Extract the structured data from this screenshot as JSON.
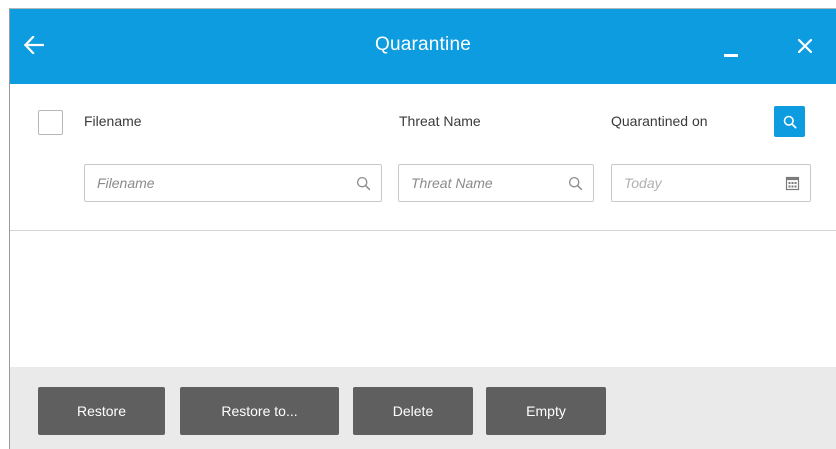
{
  "window": {
    "title": "Quarantine",
    "icons": {
      "back": "arrow-left-icon",
      "minimize": "minimize-icon",
      "close": "close-icon"
    }
  },
  "table": {
    "columns": {
      "filename": "Filename",
      "threat_name": "Threat Name",
      "quarantined_on": "Quarantined on"
    },
    "filters": {
      "filename_placeholder": "Filename",
      "threat_name_placeholder": "Threat Name",
      "date_value": "Today"
    },
    "rows": []
  },
  "actions": {
    "restore": "Restore",
    "restore_to": "Restore to...",
    "delete": "Delete",
    "empty": "Empty"
  },
  "colors": {
    "accent": "#0d9ce0",
    "button": "#5f5f5f",
    "footer_bg": "#eaeaea"
  }
}
